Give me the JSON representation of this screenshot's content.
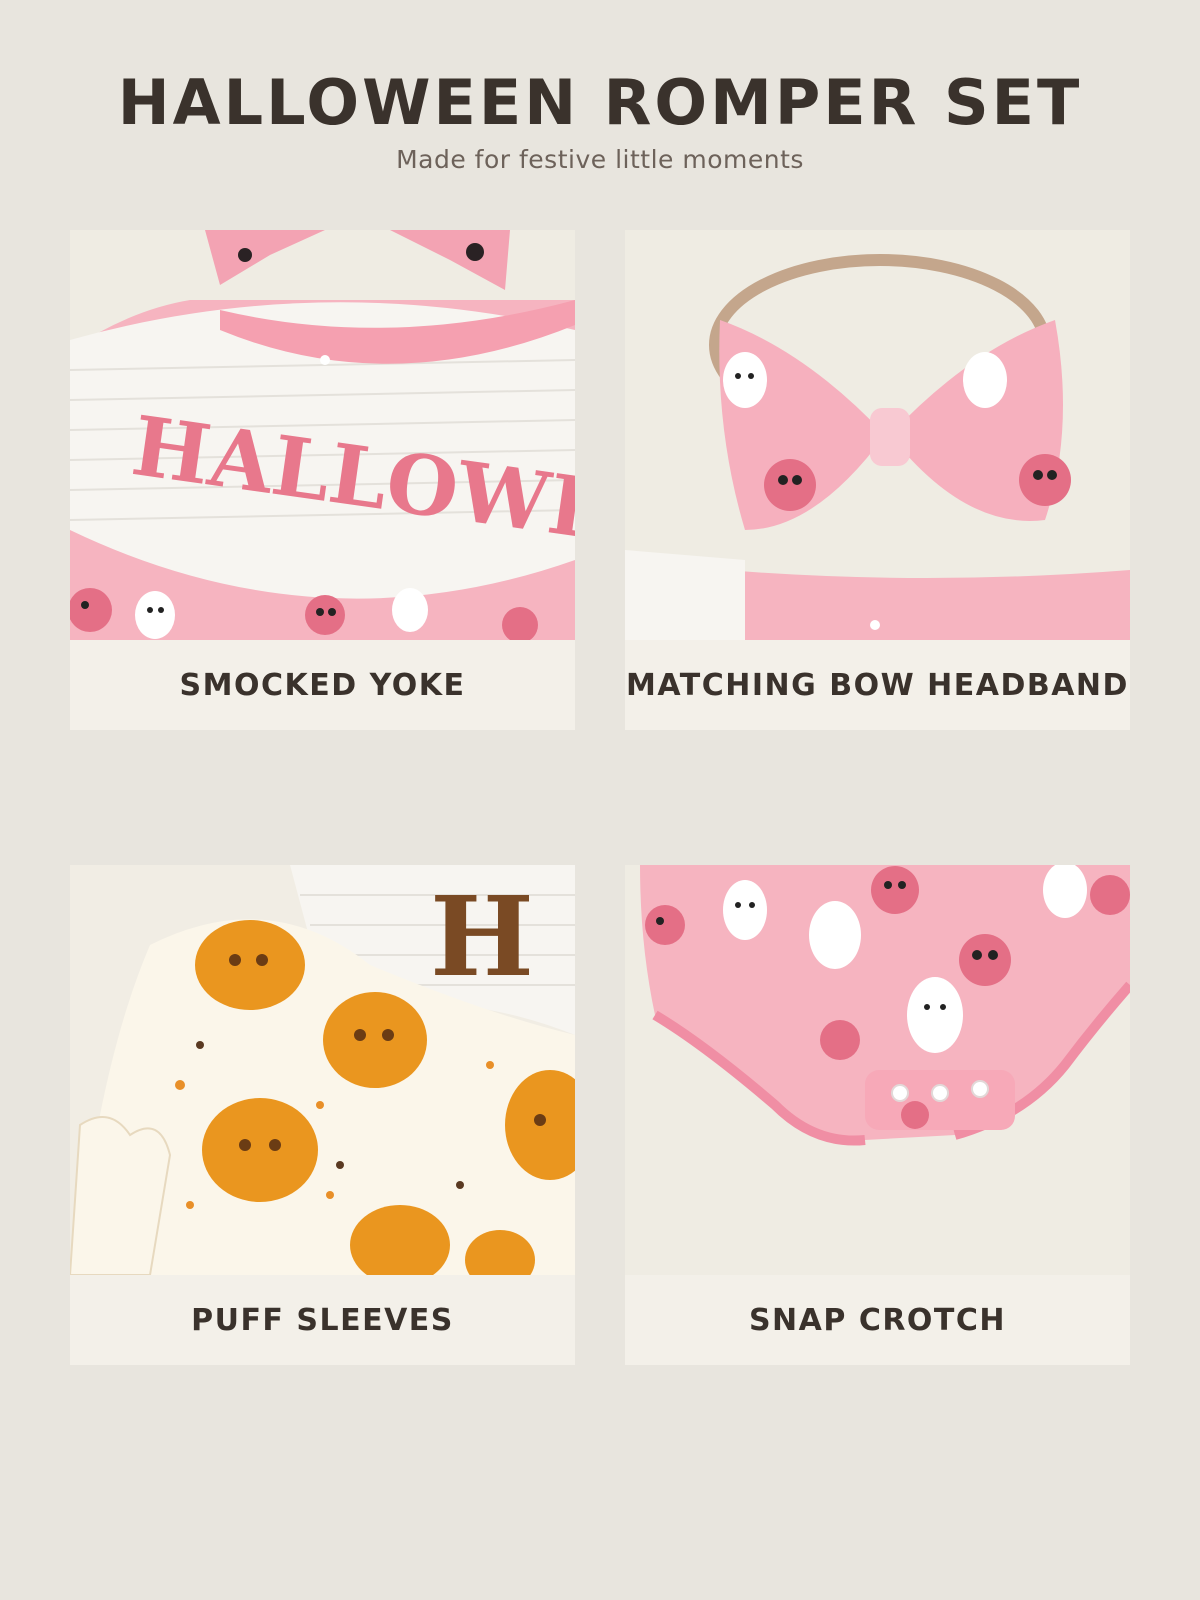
{
  "header": {
    "title": "HALLOWEEN ROMPER SET",
    "subtitle": "Made for festive little moments"
  },
  "features": [
    {
      "label": "SMOCKED YOKE",
      "embroidery": "HALLOWEEN"
    },
    {
      "label": "MATCHING BOW HEADBAND"
    },
    {
      "label": "PUFF SLEEVES",
      "embroidery": "H"
    },
    {
      "label": "SNAP CROTCH"
    }
  ],
  "colors": {
    "background": "#e8e5de",
    "card": "#f3f0e9",
    "text": "#3a322c",
    "pink": "#f4a6b4",
    "pumpkin": "#e8921c"
  }
}
